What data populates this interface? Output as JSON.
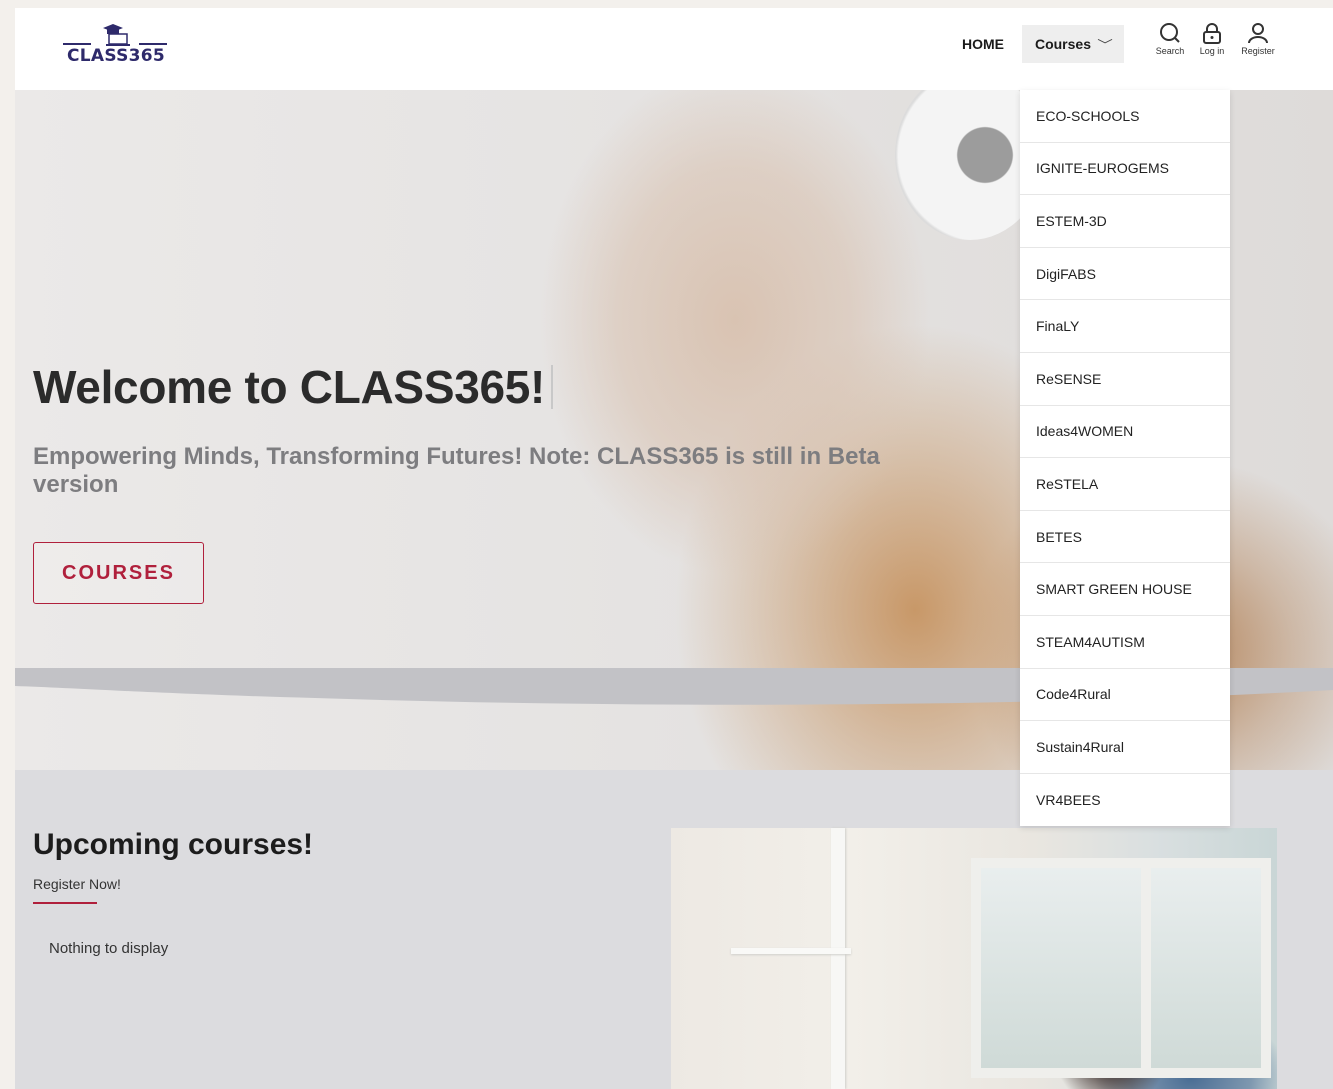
{
  "brand": {
    "logo_text": "CLASS365",
    "color": "#2e2a6b",
    "accent": "#b0203c"
  },
  "nav": {
    "home": "HOME",
    "courses": "Courses",
    "search_label": "Search",
    "login_label": "Log in",
    "register_label": "Register"
  },
  "courses_menu": [
    "ECO-SCHOOLS",
    "IGNITE-EUROGEMS",
    "ESTEM-3D",
    "DigiFABS",
    "FinaLY",
    "ReSENSE",
    "Ideas4WOMEN",
    "ReSTELA",
    "BETES",
    "SMART GREEN HOUSE",
    "STEAM4AUTISM",
    "Code4Rural",
    "Sustain4Rural",
    "VR4BEES"
  ],
  "hero": {
    "title": "Welcome to CLASS365!",
    "subtitle": "Empowering Minds, Transforming Futures! Note: CLASS365 is still in Beta version",
    "button": "COURSES"
  },
  "upcoming": {
    "title": "Upcoming courses!",
    "subtitle": "Register Now!",
    "empty_text": "Nothing to display"
  }
}
